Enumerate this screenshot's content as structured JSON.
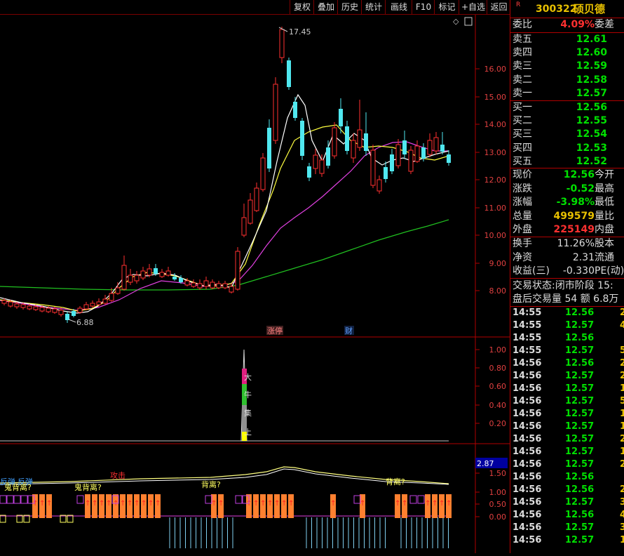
{
  "toolbar": {
    "buttons": [
      "复权",
      "叠加",
      "历史",
      "统计",
      "画线",
      "F10",
      "标记",
      "+自选",
      "返回"
    ]
  },
  "stock": {
    "marker": "R",
    "code": "300322",
    "name": "硕贝德"
  },
  "weibi": {
    "label": "委比",
    "value": "4.09%",
    "label2": "委差"
  },
  "asks": [
    {
      "label": "卖五",
      "price": "12.61"
    },
    {
      "label": "卖四",
      "price": "12.60"
    },
    {
      "label": "卖三",
      "price": "12.59"
    },
    {
      "label": "卖二",
      "price": "12.58"
    },
    {
      "label": "卖一",
      "price": "12.57"
    }
  ],
  "bids": [
    {
      "label": "买一",
      "price": "12.56"
    },
    {
      "label": "买二",
      "price": "12.55"
    },
    {
      "label": "买三",
      "price": "12.54"
    },
    {
      "label": "买四",
      "price": "12.53"
    },
    {
      "label": "买五",
      "price": "12.52"
    }
  ],
  "quote": [
    {
      "label": "现价",
      "value": "12.56",
      "label2": "今开",
      "color": "#00e000"
    },
    {
      "label": "涨跌",
      "value": "-0.52",
      "label2": "最高",
      "color": "#00e000"
    },
    {
      "label": "涨幅",
      "value": "-3.98%",
      "label2": "最低",
      "color": "#00e000"
    },
    {
      "label": "总量",
      "value": "499579",
      "label2": "量比",
      "color": "#e8c000"
    },
    {
      "label": "外盘",
      "value": "225149",
      "label2": "内盘",
      "color": "#ff3030"
    }
  ],
  "fund": [
    {
      "label": "换手",
      "value": "11.26%",
      "label2": "股本"
    },
    {
      "label": "净资",
      "value": "2.31",
      "label2": "流通"
    },
    {
      "label": "收益(三)",
      "value": "-0.330",
      "label2": "PE(动)"
    }
  ],
  "status": {
    "line1": "交易状态:闭市阶段 15:",
    "line2": "盘后交易量 54 额 6.8万"
  },
  "ticks": [
    {
      "time": "14:55",
      "price": "12.56",
      "vol": "2"
    },
    {
      "time": "14:55",
      "price": "12.57",
      "vol": "4"
    },
    {
      "time": "14:55",
      "price": "12.56",
      "vol": ""
    },
    {
      "time": "14:55",
      "price": "12.57",
      "vol": "5"
    },
    {
      "time": "14:56",
      "price": "12.56",
      "vol": "2"
    },
    {
      "time": "14:56",
      "price": "12.57",
      "vol": "2"
    },
    {
      "time": "14:56",
      "price": "12.57",
      "vol": "1"
    },
    {
      "time": "14:56",
      "price": "12.57",
      "vol": "5"
    },
    {
      "time": "14:56",
      "price": "12.57",
      "vol": "1"
    },
    {
      "time": "14:56",
      "price": "12.57",
      "vol": "1"
    },
    {
      "time": "14:56",
      "price": "12.57",
      "vol": "2"
    },
    {
      "time": "14:56",
      "price": "12.57",
      "vol": "1"
    },
    {
      "time": "14:56",
      "price": "12.57",
      "vol": "2"
    },
    {
      "time": "14:56",
      "price": "12.56",
      "vol": ""
    },
    {
      "time": "14:56",
      "price": "12.56",
      "vol": "2"
    },
    {
      "time": "14:56",
      "price": "12.57",
      "vol": "3"
    },
    {
      "time": "14:56",
      "price": "12.56",
      "vol": "4"
    },
    {
      "time": "14:56",
      "price": "12.57",
      "vol": "3"
    },
    {
      "time": "14:56",
      "price": "12.57",
      "vol": "1"
    }
  ],
  "main_chart": {
    "yticks": [
      "16.00",
      "15.00",
      "14.00",
      "13.00",
      "12.00",
      "11.00",
      "10.00",
      "9.00",
      "8.00"
    ],
    "high_label": "17.45",
    "low_label": "6.88",
    "events": [
      "涨停",
      "财"
    ],
    "corner_icon": "diamond-icon"
  },
  "indicator1": {
    "yticks": [
      "1.00",
      "0.80",
      "0.60",
      "0.40",
      "0.20"
    ],
    "vertical_chars": [
      "大",
      "牛",
      "集",
      "上"
    ]
  },
  "indicator2": {
    "value_box": "2.87",
    "yticks": [
      "1.50",
      "1.00",
      "0.50",
      "0.00"
    ],
    "labels": [
      "反弹",
      "反弹",
      "鬼背离?",
      "鬼背离?",
      "攻击",
      "背离?",
      "背离?"
    ]
  },
  "colors": {
    "up": "#ff3030",
    "down": "#50e8f0",
    "ma5": "#ffffff",
    "ma10": "#ffff40",
    "ma20": "#e040e0",
    "ma60": "#20c020",
    "border": "#b00000"
  }
}
